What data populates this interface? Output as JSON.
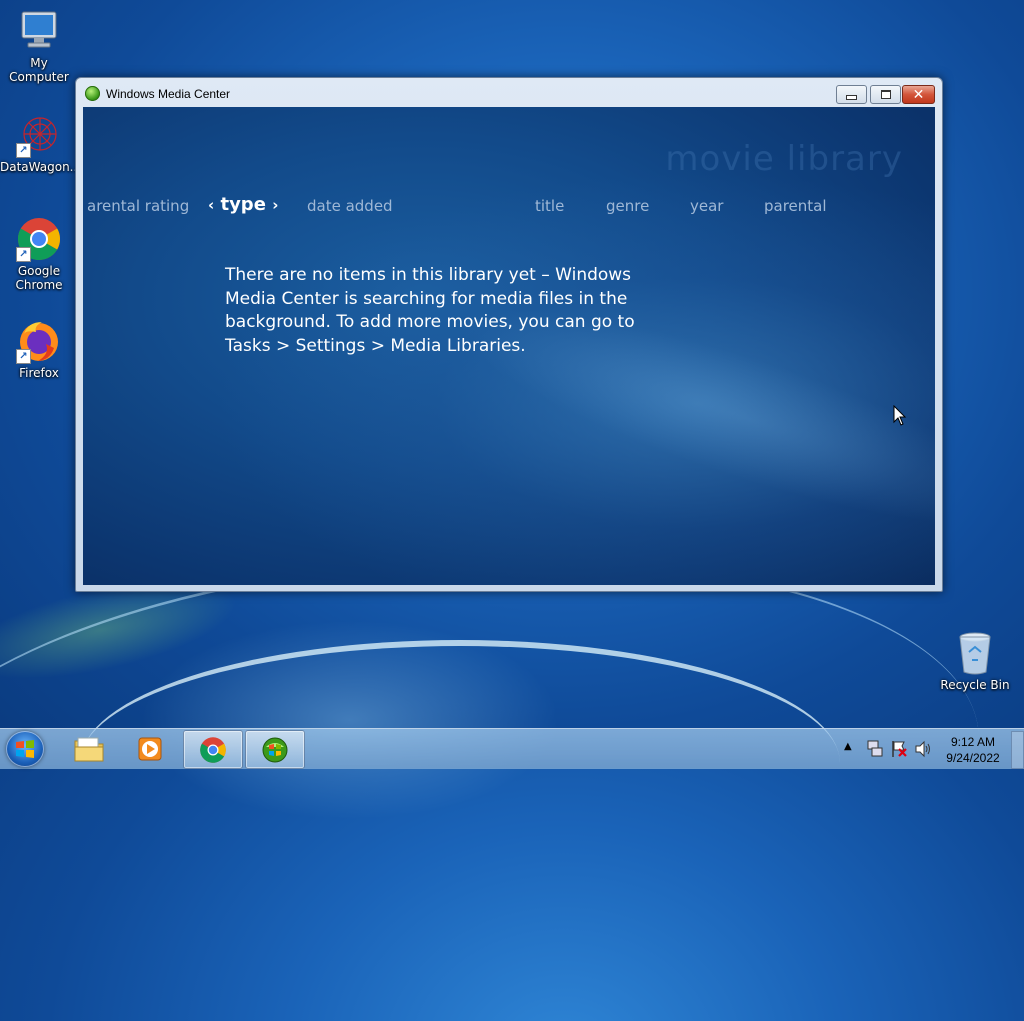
{
  "desktop": {
    "icons": [
      {
        "label": "My Computer"
      },
      {
        "label": "DataWagon..."
      },
      {
        "label": "Google Chrome"
      },
      {
        "label": "Firefox"
      },
      {
        "label": "Recycle Bin"
      }
    ]
  },
  "window": {
    "title": "Windows Media Center",
    "library_title": "movie library",
    "sort": {
      "left_item": "arental rating",
      "current": "type",
      "items": [
        "date added",
        "title",
        "genre",
        "year",
        "parental"
      ]
    },
    "message": "There are no items in this library yet – Windows Media Center is searching for media files in the background. To add more movies, you can go to Tasks > Settings > Media Libraries."
  },
  "taskbar": {
    "time": "9:12 AM",
    "date": "9/24/2022"
  },
  "colors": {
    "desktop": "#1a63b8",
    "mc_background": "#124a8a",
    "close_button": "#c0381d"
  }
}
